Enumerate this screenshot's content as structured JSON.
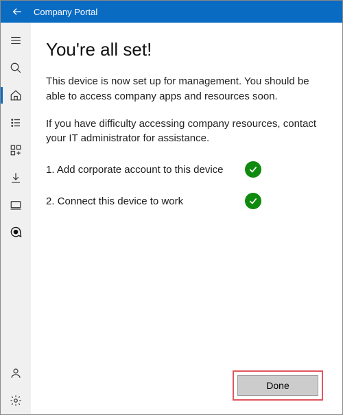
{
  "titlebar": {
    "title": "Company Portal"
  },
  "sidebar": {
    "items": [
      {
        "name": "menu-icon"
      },
      {
        "name": "search-icon"
      },
      {
        "name": "home-icon",
        "active": true
      },
      {
        "name": "list-icon"
      },
      {
        "name": "apps-icon"
      },
      {
        "name": "download-icon"
      },
      {
        "name": "device-icon"
      },
      {
        "name": "support-icon"
      }
    ],
    "bottom": [
      {
        "name": "account-icon"
      },
      {
        "name": "settings-icon"
      }
    ]
  },
  "main": {
    "heading": "You're all set!",
    "para1": "This device is now set up for management.  You should be able to access company apps and resources soon.",
    "para2": "If you have difficulty accessing company resources, contact your IT administrator for assistance.",
    "steps": [
      {
        "label": "1. Add corporate account to this device"
      },
      {
        "label": "2. Connect this device to work"
      }
    ],
    "done_label": "Done"
  }
}
